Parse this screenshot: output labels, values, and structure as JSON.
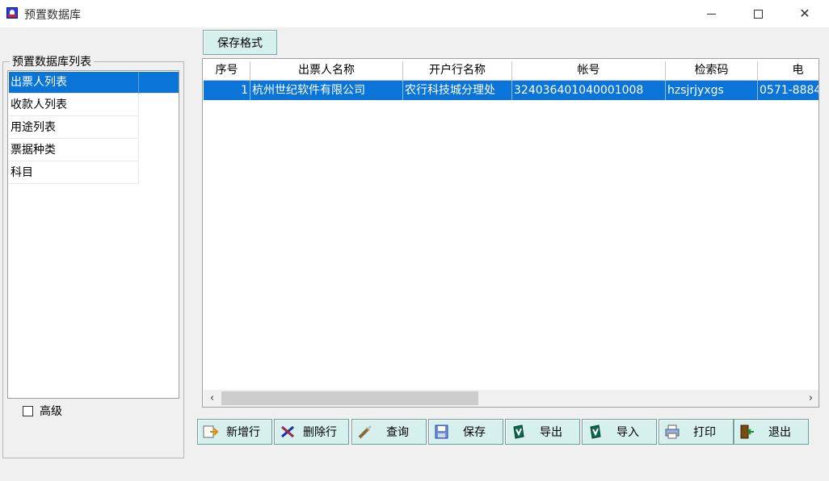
{
  "window": {
    "title": "预置数据库",
    "minimize_icon": "minimize-icon",
    "maximize_icon": "maximize-icon",
    "close_icon": "close-icon"
  },
  "toolbar_top": {
    "save_format_label": "保存格式"
  },
  "sidebar": {
    "group_title": "预置数据库列表",
    "items": [
      {
        "label": "出票人列表",
        "selected": true
      },
      {
        "label": "收款人列表",
        "selected": false
      },
      {
        "label": "用途列表",
        "selected": false
      },
      {
        "label": "票据种类",
        "selected": false
      },
      {
        "label": "科目",
        "selected": false
      }
    ],
    "advanced_label": "高级",
    "advanced_checked": false
  },
  "table": {
    "columns": [
      "序号",
      "出票人名称",
      "开户行名称",
      "帐号",
      "检索码",
      "电"
    ],
    "rows": [
      [
        "1",
        "杭州世纪软件有限公司",
        "农行科技城分理处",
        "324036401040001008",
        "hzsjrjyxgs",
        "0571-8884"
      ]
    ]
  },
  "actions": [
    {
      "label": "新增行",
      "icon": "add-row-icon"
    },
    {
      "label": "删除行",
      "icon": "delete-row-icon"
    },
    {
      "label": "查询",
      "icon": "query-icon"
    },
    {
      "label": "保存",
      "icon": "save-icon"
    },
    {
      "label": "导出",
      "icon": "export-icon"
    },
    {
      "label": "导入",
      "icon": "import-icon"
    },
    {
      "label": "打印",
      "icon": "print-icon"
    },
    {
      "label": "退出",
      "icon": "exit-icon"
    }
  ],
  "colors": {
    "selection": "#0a74d8",
    "button_bg": "#d6f0ee",
    "window_bg": "#f0f0f0"
  }
}
